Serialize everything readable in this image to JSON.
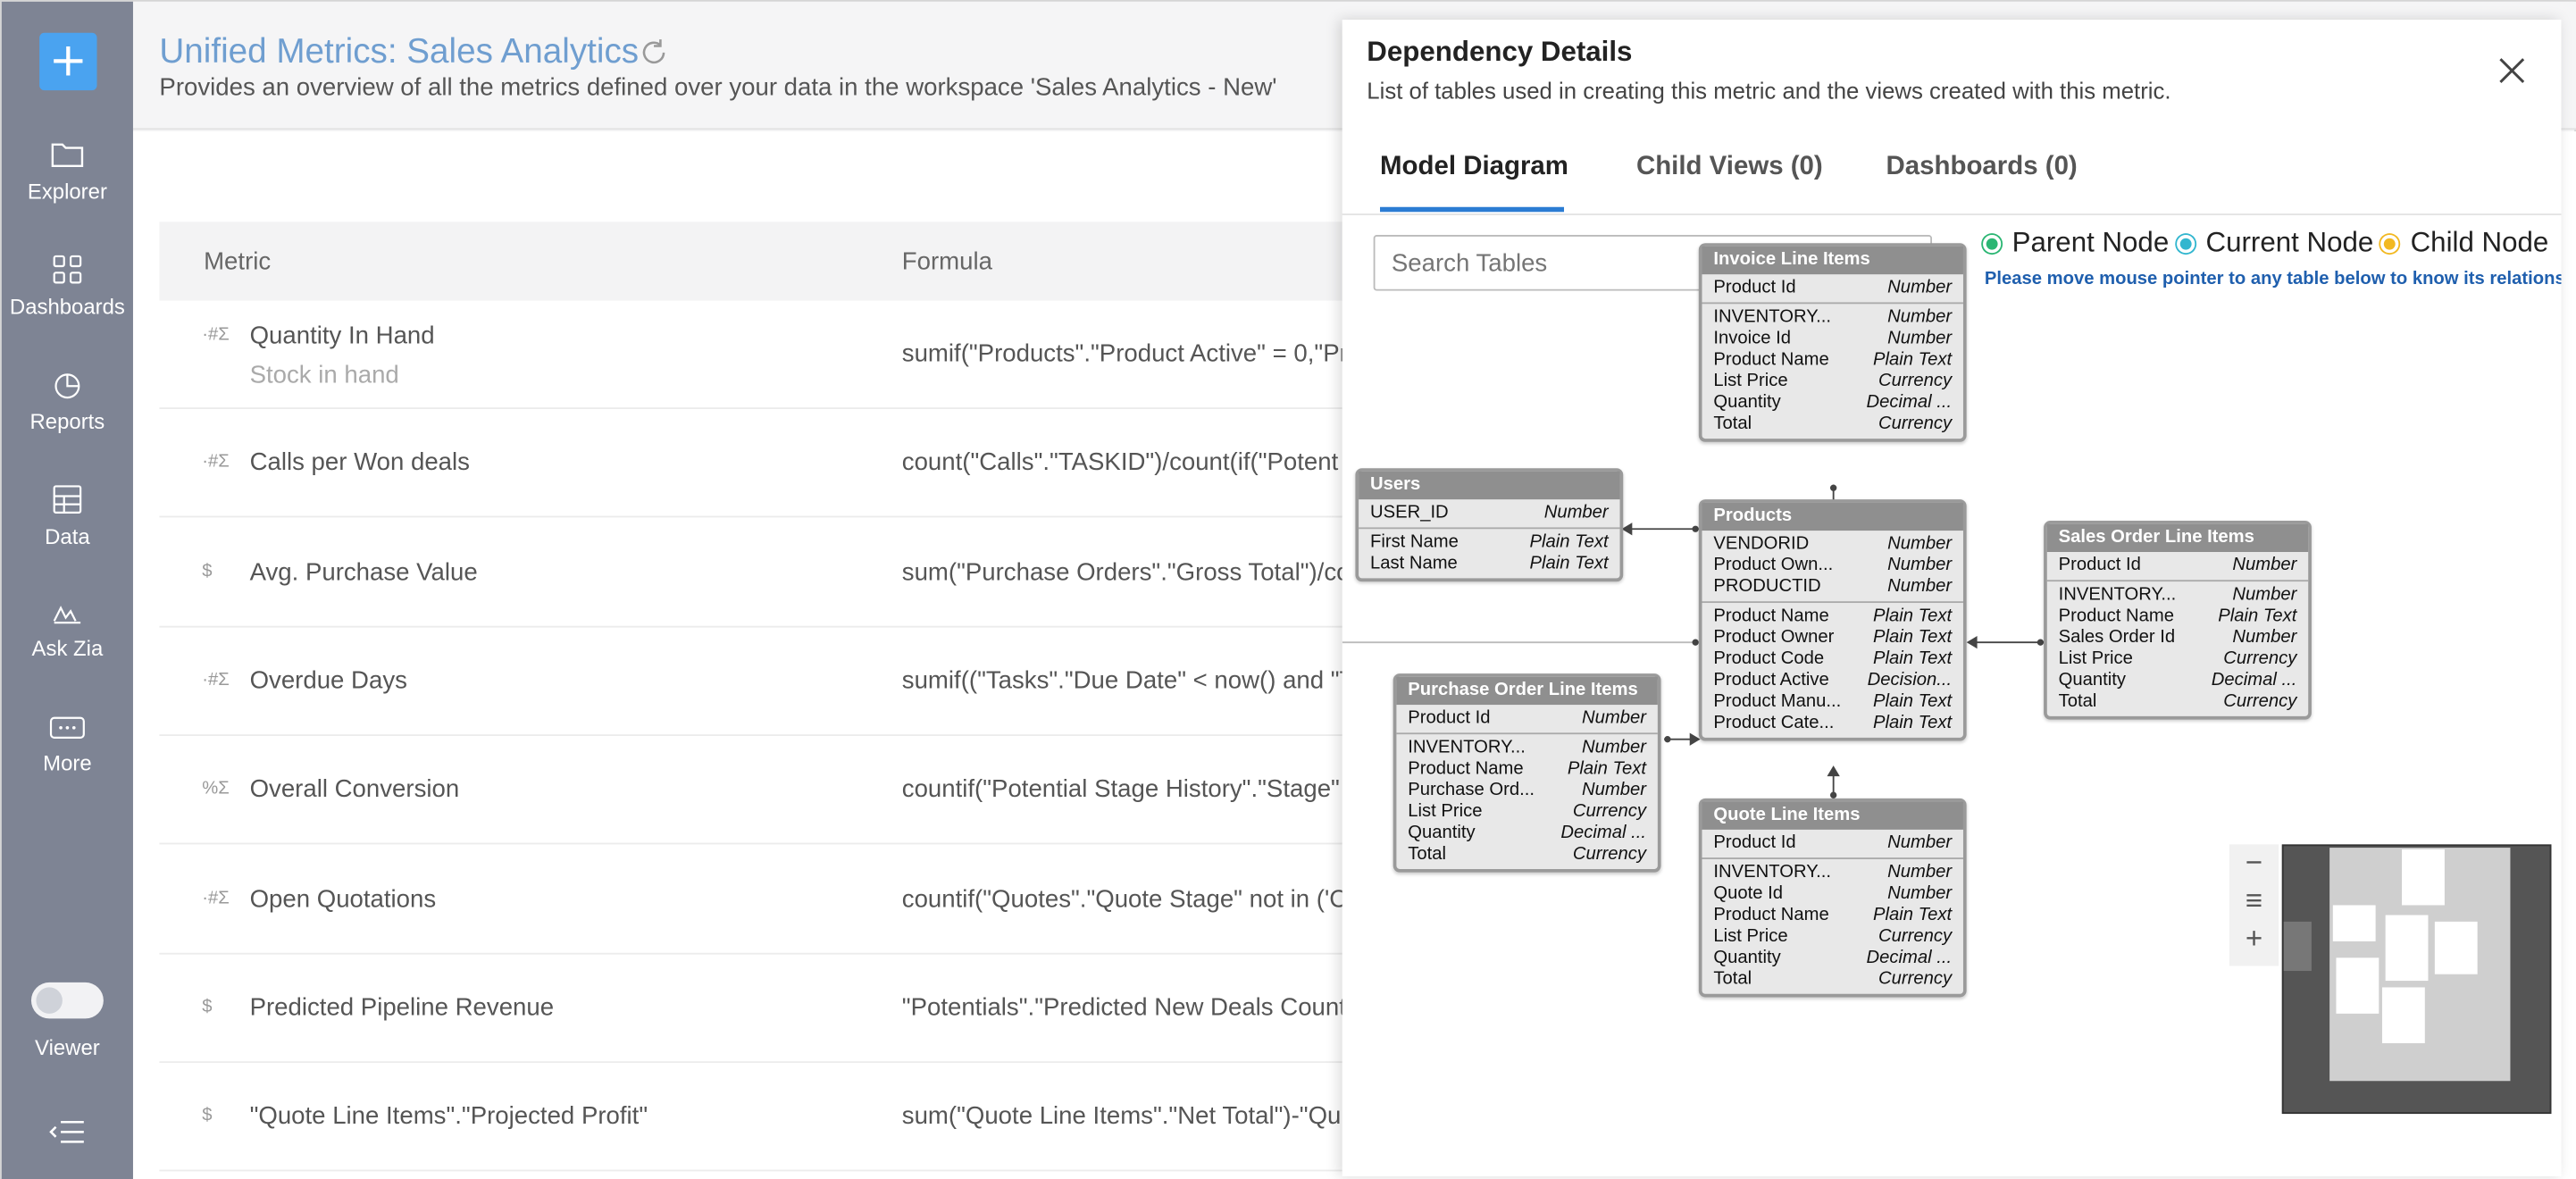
{
  "sidebar": {
    "add_label": "+",
    "items": [
      {
        "label": "Explorer",
        "icon": "folder-icon"
      },
      {
        "label": "Dashboards",
        "icon": "dashboards-icon"
      },
      {
        "label": "Reports",
        "icon": "reports-icon"
      },
      {
        "label": "Data",
        "icon": "data-icon"
      },
      {
        "label": "Ask Zia",
        "icon": "ask-zia-icon"
      },
      {
        "label": "More",
        "icon": "more-icon"
      }
    ],
    "viewer_label": "Viewer"
  },
  "header": {
    "title": "Unified Metrics: Sales Analytics",
    "subtitle": "Provides an overview of all the metrics defined over your data in the workspace 'Sales Analytics - New'"
  },
  "table": {
    "col_metric": "Metric",
    "col_formula": "Formula",
    "rows": [
      {
        "icon": "·#Σ",
        "name": "Quantity In Hand",
        "sub": "Stock in hand",
        "formula": "sumif(\"Products\".\"Product Active\" = 0,\"Pr"
      },
      {
        "icon": "·#Σ",
        "name": "Calls per Won deals",
        "sub": "",
        "formula": "count(\"Calls\".\"TASKID\")/count(if(\"Potent"
      },
      {
        "icon": "$",
        "name": "Avg. Purchase Value",
        "sub": "",
        "formula": "sum(\"Purchase Orders\".\"Gross Total\")/co"
      },
      {
        "icon": "·#Σ",
        "name": "Overdue Days",
        "sub": "",
        "formula": "sumif((\"Tasks\".\"Due Date\" < now() and \"Ta"
      },
      {
        "icon": "%Σ",
        "name": "Overall Conversion",
        "sub": "",
        "formula": "countif(\"Potential Stage History\".\"Stage\""
      },
      {
        "icon": "·#Σ",
        "name": "Open Quotations",
        "sub": "",
        "formula": "countif(\"Quotes\".\"Quote Stage\" not in ('C"
      },
      {
        "icon": "$",
        "name": "Predicted Pipeline Revenue",
        "sub": "",
        "formula": "\"Potentials\".\"Predicted New Deals Count"
      },
      {
        "icon": "$",
        "name": "\"Quote Line Items\".\"Projected Profit\"",
        "sub": "",
        "formula": "sum(\"Quote Line Items\".\"Net Total\")-\"Qu"
      }
    ]
  },
  "panel": {
    "title": "Dependency Details",
    "subtitle": "List of tables used in creating this metric and the views created with this metric.",
    "tabs": [
      "Model Diagram",
      "Child Views (0)",
      "Dashboards (0)"
    ],
    "search_placeholder": "Search Tables",
    "legend": {
      "parent": "Parent Node",
      "current": "Current Node",
      "child": "Child Node",
      "parent_color": "#2bb673",
      "current_color": "#31b6cf",
      "child_color": "#f2b821"
    },
    "hint": "Please move mouse pointer to any table below to know its relations",
    "zoom": {
      "minus": "−",
      "filter": "≡",
      "plus": "+"
    }
  },
  "tables": {
    "invoice": {
      "title": "Invoice Line Items",
      "keys": [
        [
          "Product Id",
          "Number"
        ]
      ],
      "fields": [
        [
          "INVENTORY...",
          "Number"
        ],
        [
          "Invoice Id",
          "Number"
        ],
        [
          "Product Name",
          "Plain Text"
        ],
        [
          "List Price",
          "Currency"
        ],
        [
          "Quantity",
          "Decimal ..."
        ],
        [
          "Total",
          "Currency"
        ]
      ]
    },
    "users": {
      "title": "Users",
      "keys": [
        [
          "USER_ID",
          "Number"
        ]
      ],
      "fields": [
        [
          "First Name",
          "Plain Text"
        ],
        [
          "Last Name",
          "Plain Text"
        ]
      ]
    },
    "products": {
      "title": "Products",
      "keys": [
        [
          "VENDORID",
          "Number"
        ],
        [
          "Product Own...",
          "Number"
        ],
        [
          "PRODUCTID",
          "Number"
        ]
      ],
      "fields": [
        [
          "Product Name",
          "Plain Text"
        ],
        [
          "Product Owner",
          "Plain Text"
        ],
        [
          "Product Code",
          "Plain Text"
        ],
        [
          "Product Active",
          "Decision..."
        ],
        [
          "Product Manu...",
          "Plain Text"
        ],
        [
          "Product Cate...",
          "Plain Text"
        ]
      ]
    },
    "sales": {
      "title": "Sales Order Line Items",
      "keys": [
        [
          "Product Id",
          "Number"
        ]
      ],
      "fields": [
        [
          "INVENTORY...",
          "Number"
        ],
        [
          "Product Name",
          "Plain Text"
        ],
        [
          "Sales Order Id",
          "Number"
        ],
        [
          "List Price",
          "Currency"
        ],
        [
          "Quantity",
          "Decimal ..."
        ],
        [
          "Total",
          "Currency"
        ]
      ]
    },
    "purchase": {
      "title": "Purchase Order Line Items",
      "keys": [
        [
          "Product Id",
          "Number"
        ]
      ],
      "fields": [
        [
          "INVENTORY...",
          "Number"
        ],
        [
          "Product Name",
          "Plain Text"
        ],
        [
          "Purchase Ord...",
          "Number"
        ],
        [
          "List Price",
          "Currency"
        ],
        [
          "Quantity",
          "Decimal ..."
        ],
        [
          "Total",
          "Currency"
        ]
      ]
    },
    "quote": {
      "title": "Quote Line Items",
      "keys": [
        [
          "Product Id",
          "Number"
        ]
      ],
      "fields": [
        [
          "INVENTORY...",
          "Number"
        ],
        [
          "Quote Id",
          "Number"
        ],
        [
          "Product Name",
          "Plain Text"
        ],
        [
          "List Price",
          "Currency"
        ],
        [
          "Quantity",
          "Decimal ..."
        ],
        [
          "Total",
          "Currency"
        ]
      ]
    }
  }
}
